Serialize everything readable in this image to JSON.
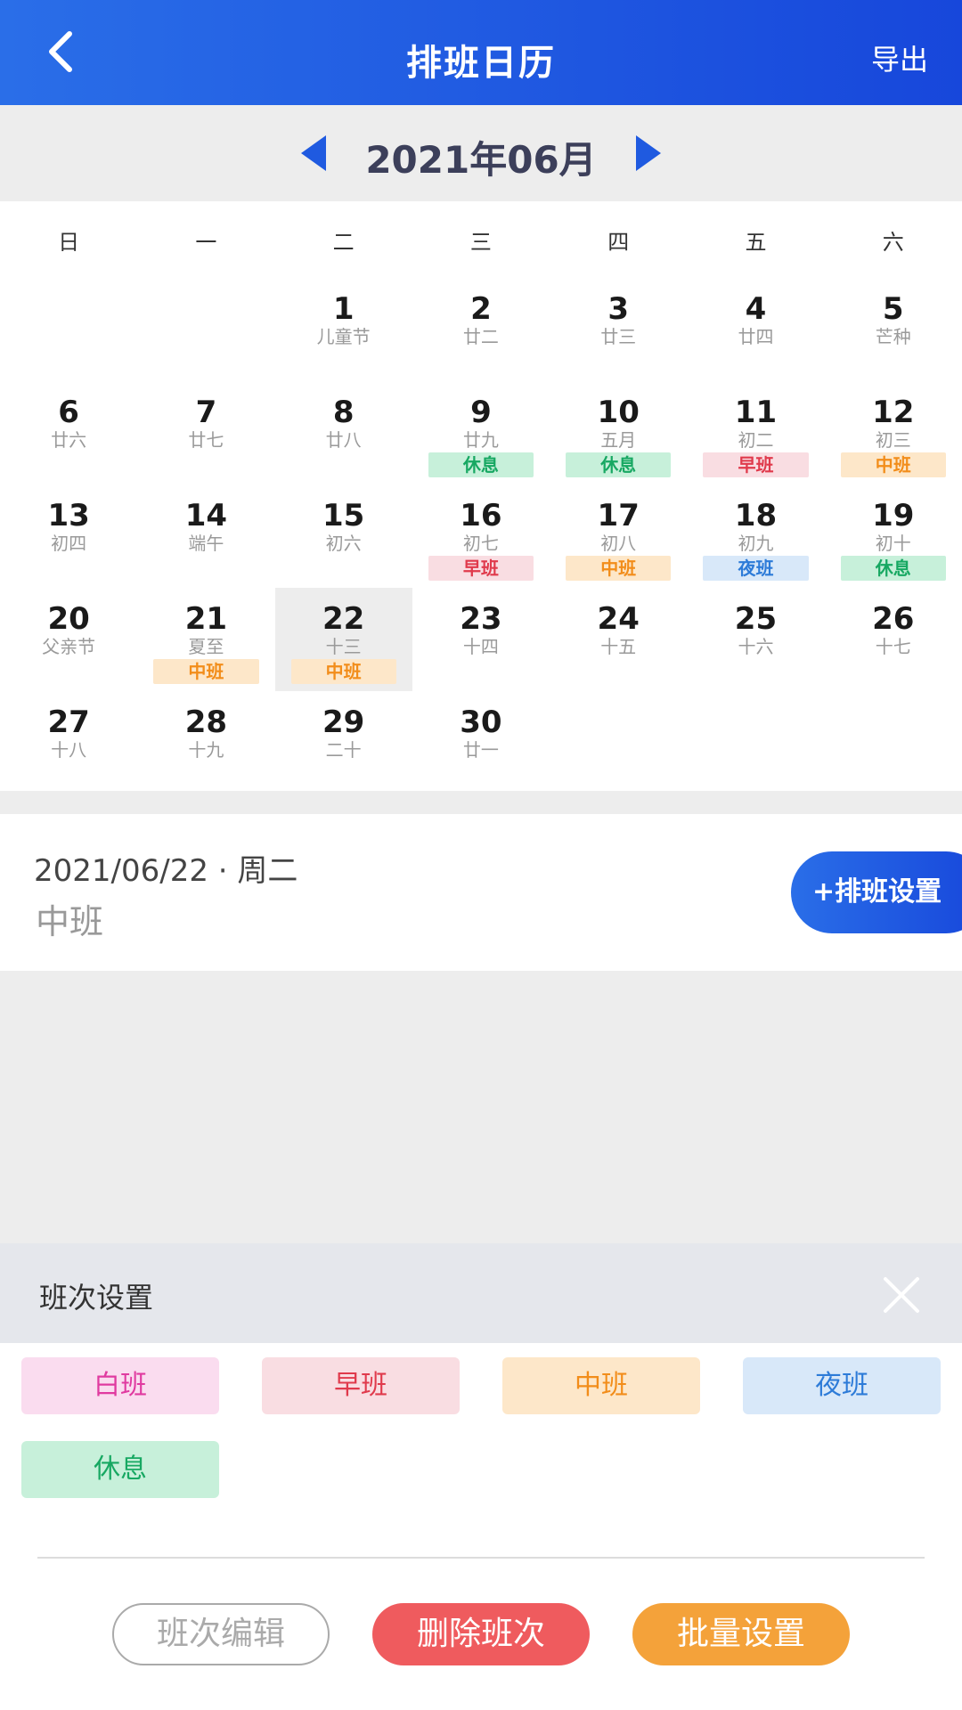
{
  "header": {
    "title": "排班日历",
    "export_label": "导出"
  },
  "month": {
    "label": "2021年06月"
  },
  "weekdays": [
    "日",
    "一",
    "二",
    "三",
    "四",
    "五",
    "六"
  ],
  "days": [
    {
      "d": "",
      "l": ""
    },
    {
      "d": "",
      "l": ""
    },
    {
      "d": "1",
      "l": "儿童节"
    },
    {
      "d": "2",
      "l": "廿二"
    },
    {
      "d": "3",
      "l": "廿三"
    },
    {
      "d": "4",
      "l": "廿四"
    },
    {
      "d": "5",
      "l": "芒种"
    },
    {
      "d": "6",
      "l": "廿六"
    },
    {
      "d": "7",
      "l": "廿七"
    },
    {
      "d": "8",
      "l": "廿八"
    },
    {
      "d": "9",
      "l": "廿九",
      "tag": "休息",
      "t": "rest"
    },
    {
      "d": "10",
      "l": "五月",
      "tag": "休息",
      "t": "rest"
    },
    {
      "d": "11",
      "l": "初二",
      "tag": "早班",
      "t": "early"
    },
    {
      "d": "12",
      "l": "初三",
      "tag": "中班",
      "t": "mid"
    },
    {
      "d": "13",
      "l": "初四"
    },
    {
      "d": "14",
      "l": "端午"
    },
    {
      "d": "15",
      "l": "初六"
    },
    {
      "d": "16",
      "l": "初七",
      "tag": "早班",
      "t": "early"
    },
    {
      "d": "17",
      "l": "初八",
      "tag": "中班",
      "t": "mid"
    },
    {
      "d": "18",
      "l": "初九",
      "tag": "夜班",
      "t": "night"
    },
    {
      "d": "19",
      "l": "初十",
      "tag": "休息",
      "t": "rest"
    },
    {
      "d": "20",
      "l": "父亲节"
    },
    {
      "d": "21",
      "l": "夏至",
      "tag": "中班",
      "t": "mid"
    },
    {
      "d": "22",
      "l": "十三",
      "tag": "中班",
      "t": "mid",
      "selected": true
    },
    {
      "d": "23",
      "l": "十四"
    },
    {
      "d": "24",
      "l": "十五"
    },
    {
      "d": "25",
      "l": "十六"
    },
    {
      "d": "26",
      "l": "十七"
    },
    {
      "d": "27",
      "l": "十八"
    },
    {
      "d": "28",
      "l": "十九"
    },
    {
      "d": "29",
      "l": "二十"
    },
    {
      "d": "30",
      "l": "廿一"
    }
  ],
  "selected_info": {
    "date": "2021/06/22 · 周二",
    "shift": "中班",
    "set_button": "+排班设置"
  },
  "shift_panel": {
    "title": "班次设置",
    "options": [
      {
        "label": "白班",
        "t": "white"
      },
      {
        "label": "早班",
        "t": "early"
      },
      {
        "label": "中班",
        "t": "mid"
      },
      {
        "label": "夜班",
        "t": "night"
      },
      {
        "label": "休息",
        "t": "rest"
      }
    ],
    "edit_label": "班次编辑",
    "delete_label": "删除班次",
    "batch_label": "批量设置"
  },
  "colors": {
    "brand": "#1f5ae0",
    "rest": "#17a862",
    "early": "#e03a4c",
    "mid": "#f28d1a",
    "night": "#2d7bd8",
    "white": "#e03aa0"
  }
}
